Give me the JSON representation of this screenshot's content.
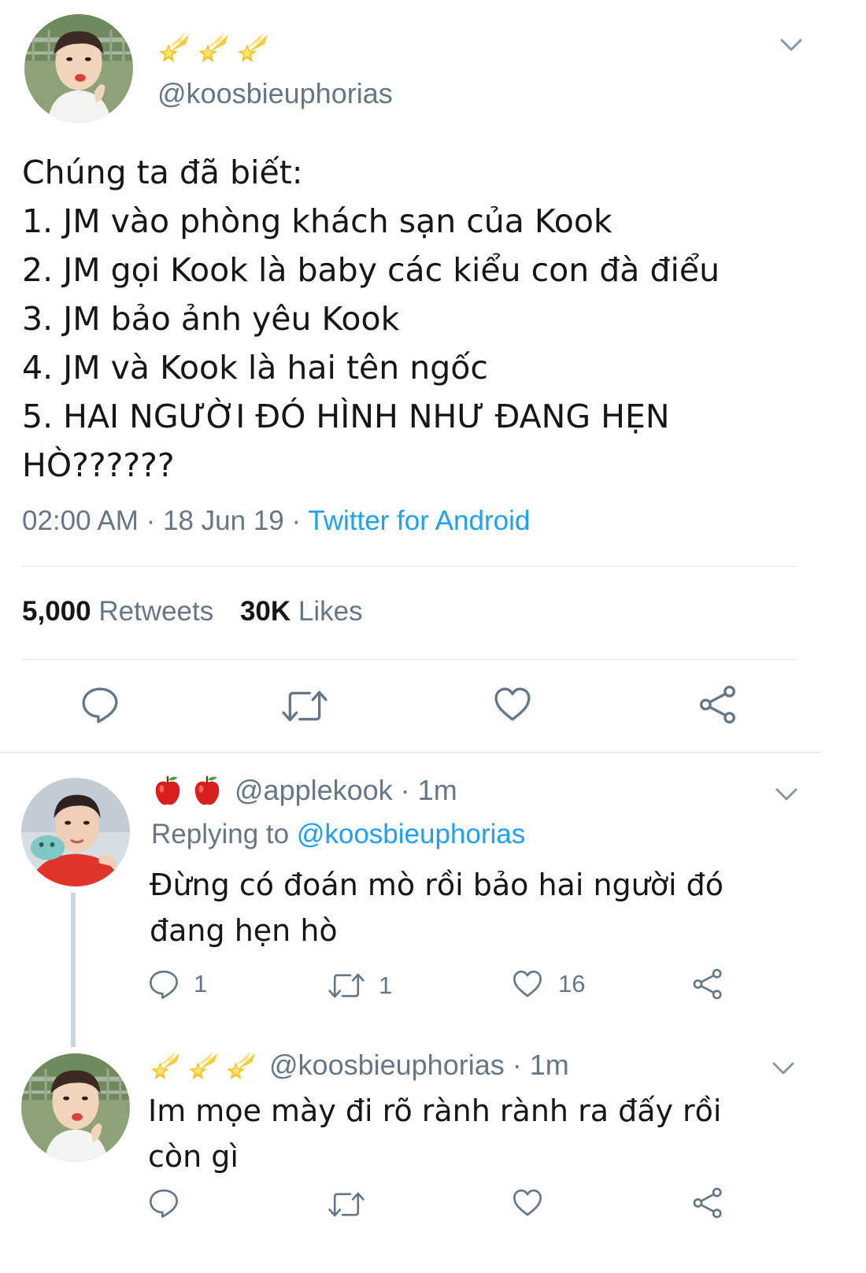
{
  "main_tweet": {
    "display_name_emoji": [
      "shooting-star-icon",
      "shooting-star-icon",
      "shooting-star-icon"
    ],
    "handle": "@koosbieuphorias",
    "lines": [
      "Chúng ta đã biết:",
      "1. JM vào phòng khách sạn của Kook",
      "2. JM gọi Kook là baby các kiểu con đà điểu",
      "3. JM bảo ảnh yêu Kook",
      "4. JM và Kook là hai tên ngốc",
      "5. HAI NGƯỜI ĐÓ HÌNH NHƯ ĐANG HẸN",
      "HÒ??????"
    ],
    "time": "02:00 AM",
    "date": "18 Jun 19",
    "separator": "·",
    "source": "Twitter for Android",
    "retweets_count": "5,000",
    "retweets_label": "Retweets",
    "likes_count": "30K",
    "likes_label": "Likes"
  },
  "replies": [
    {
      "display_name_emoji": [
        "red-apple-icon",
        "red-apple-icon"
      ],
      "handle": "@applekook",
      "separator": "·",
      "time": "1m",
      "replying_to_label": "Replying to",
      "replying_to_handle": "@koosbieuphorias",
      "lines": [
        "Đừng có đoán mò rồi bảo hai người đó",
        "đang hẹn hò"
      ],
      "reply_count": "1",
      "retweet_count": "1",
      "like_count": "16"
    },
    {
      "display_name_emoji": [
        "shooting-star-icon",
        "shooting-star-icon",
        "shooting-star-icon"
      ],
      "handle": "@koosbieuphorias",
      "separator": "·",
      "time": "1m",
      "lines": [
        "Im mọe mày đi rõ rành rành ra đấy rồi",
        "còn gì"
      ]
    }
  ],
  "colors": {
    "text": "#14171a",
    "muted": "#657786",
    "link": "#1da1f2",
    "divider": "#e1e8ed",
    "thread_line": "#ccd6dd",
    "star": "#f7c21b",
    "apple": "#d81e1e"
  }
}
